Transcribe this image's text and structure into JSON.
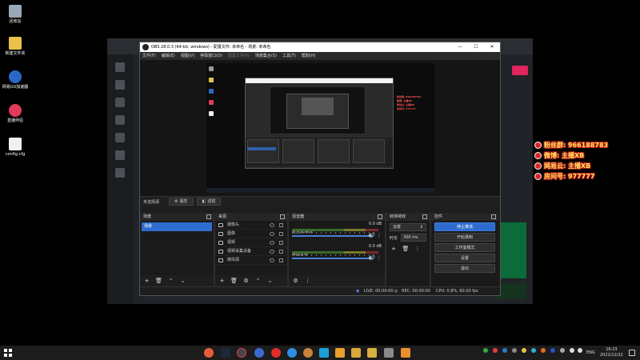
{
  "desktop": {
    "icons": [
      {
        "label": "回收站",
        "color": "#9aa7b8"
      },
      {
        "label": "新建文件夹",
        "color": "#e8c04a"
      },
      {
        "label": "网易UU加速器",
        "color": "#2a68c8"
      },
      {
        "label": "直播伴侣",
        "color": "#e23b5a"
      },
      {
        "label": "config.cfg",
        "color": "#f0f0f0"
      }
    ]
  },
  "obs": {
    "title": "OBS 28.0.3 (64-bit, windows) - 配置文件: 未命名 - 场景: 未命名",
    "window_controls": [
      "—",
      "☐",
      "✕"
    ],
    "menu": [
      "文件(F)",
      "编辑(E)",
      "视图(V)",
      "停靠窗口(D)",
      "配置文件(P)",
      "场景集合(S)",
      "工具(T)",
      "帮助(H)"
    ],
    "source_bar": {
      "label": "未选择源",
      "properties": "属性",
      "filters": "滤镜"
    },
    "scenes": {
      "title": "场景",
      "items": [
        "场景"
      ]
    },
    "sources": {
      "title": "来源",
      "items": [
        "摄像头",
        "图像",
        "视频",
        "视频采集设备",
        "媒体源"
      ]
    },
    "mixer": {
      "title": "混音器",
      "tracks": [
        {
          "name": "麦克风/Aux",
          "db": "0.0 dB"
        },
        {
          "name": "桌面音频",
          "db": "0.0 dB"
        }
      ]
    },
    "transitions": {
      "title": "转场特效",
      "selected": "淡变",
      "duration_label": "时长",
      "duration_value": "300 ms"
    },
    "controls": {
      "title": "控件",
      "buttons": [
        "停止推流",
        "开始录制",
        "工作室模式",
        "设置",
        "退出"
      ]
    },
    "status": {
      "live": "LIVE: 00:00:00",
      "rec": "REC: 00:00:00",
      "cpu": "CPU: 0.8%, 60.00 fps"
    }
  },
  "overlay": {
    "rows": [
      "粉丝群: 966188783",
      "微博: 主播XB",
      "网易云: 主播XB",
      "房间号: 977777"
    ]
  },
  "taskbar": {
    "lang": "ENG",
    "time": "16:23",
    "date": "2022/12/22"
  }
}
